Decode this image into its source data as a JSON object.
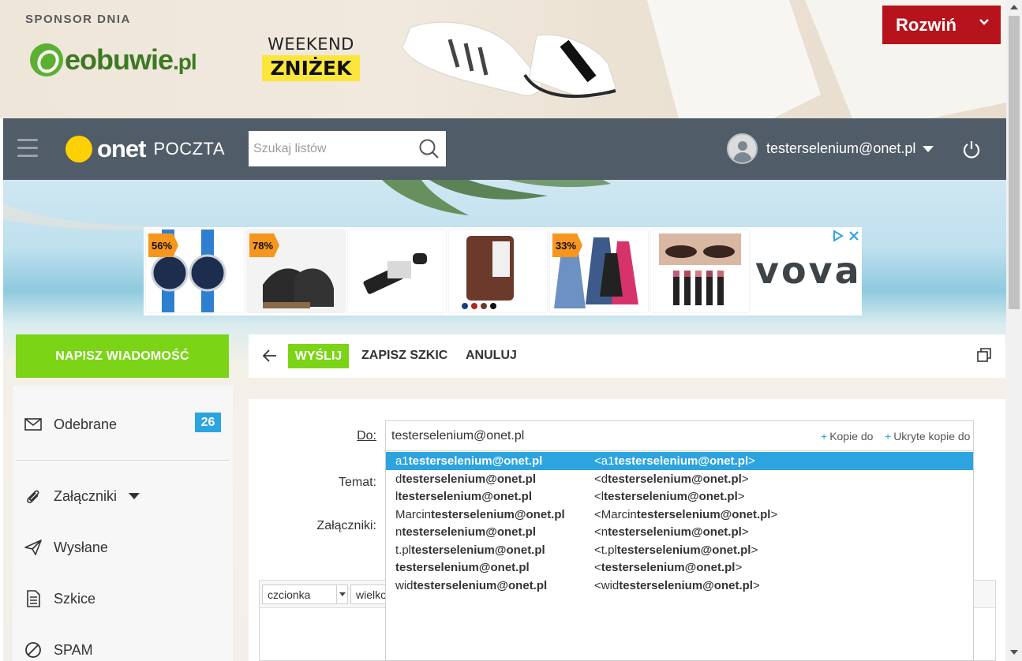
{
  "sponsor": {
    "label": "SPONSOR DNIA",
    "logo_text": "eobuwie",
    "logo_suffix": ".pl",
    "promo_top": "WEEKEND",
    "promo_box": "ZNIŻEK",
    "expand_label": "Rozwiń"
  },
  "header": {
    "brand": "onet",
    "product": "POCZTA",
    "search_placeholder": "Szukaj listów",
    "user_email": "testerselenium@onet.pl"
  },
  "ad": {
    "brand": "vova",
    "items": [
      {
        "discount": "56%"
      },
      {
        "discount": "78%"
      },
      {
        "discount": ""
      },
      {
        "discount": ""
      },
      {
        "discount": "33%"
      },
      {
        "discount": ""
      }
    ]
  },
  "sidebar": {
    "compose_label": "NAPISZ WIADOMOŚĆ",
    "items": [
      {
        "label": "Odebrane",
        "count": "26",
        "icon": "envelope-icon"
      },
      {
        "label": "Załączniki",
        "icon": "paperclip-icon"
      },
      {
        "label": "Wysłane",
        "icon": "paper-plane-icon"
      },
      {
        "label": "Szkice",
        "icon": "document-icon"
      },
      {
        "label": "SPAM",
        "icon": "ban-icon"
      }
    ]
  },
  "toolbar": {
    "send_label": "WYŚLIJ",
    "save_draft_label": "ZAPISZ SZKIC",
    "cancel_label": "ANULUJ"
  },
  "compose": {
    "to_label": "Do:",
    "to_value": "testerselenium@onet.pl",
    "cc_label": "Kopie do",
    "bcc_label": "Ukryte kopie do",
    "subject_label": "Temat:",
    "attachments_label": "Załączniki:",
    "font_select": "czcionka",
    "size_select": "wielko"
  },
  "autocomplete": {
    "rows": [
      {
        "prefix": "a1",
        "match": "testerselenium@onet.pl",
        "addr_prefix": "<a1",
        "addr_match": "testerselenium@onet.pl",
        "addr_suffix": ">",
        "active": true
      },
      {
        "prefix": "d",
        "match": "testerselenium@onet.pl",
        "addr_prefix": "<d",
        "addr_match": "testerselenium@onet.pl",
        "addr_suffix": ">",
        "active": false
      },
      {
        "prefix": "l",
        "match": "testerselenium@onet.pl",
        "addr_prefix": "<l",
        "addr_match": "testerselenium@onet.pl",
        "addr_suffix": ">",
        "active": false
      },
      {
        "prefix": "Marcin",
        "match": "testerselenium@onet.pl",
        "addr_prefix": "<Marcin",
        "addr_match": "testerselenium@onet.pl",
        "addr_suffix": ">",
        "active": false
      },
      {
        "prefix": "n",
        "match": "testerselenium@onet.pl",
        "addr_prefix": "<n",
        "addr_match": "testerselenium@onet.pl",
        "addr_suffix": ">",
        "active": false
      },
      {
        "prefix": "t.pl",
        "match": "testerselenium@onet.pl",
        "addr_prefix": "<t.pl",
        "addr_match": "testerselenium@onet.pl",
        "addr_suffix": ">",
        "active": false
      },
      {
        "prefix": "",
        "match": "testerselenium@onet.pl",
        "addr_prefix": "<",
        "addr_match": "testerselenium@onet.pl",
        "addr_suffix": ">",
        "active": false
      },
      {
        "prefix": "wid",
        "match": "testerselenium@onet.pl",
        "addr_prefix": "<wid",
        "addr_match": "testerselenium@onet.pl",
        "addr_suffix": ">",
        "active": false
      }
    ]
  },
  "colors": {
    "accent_green": "#7cd417",
    "header_bg": "#505c68",
    "highlight_blue": "#2ba4e0",
    "sponsor_red": "#b7131d",
    "onet_yellow": "#fdd100"
  }
}
